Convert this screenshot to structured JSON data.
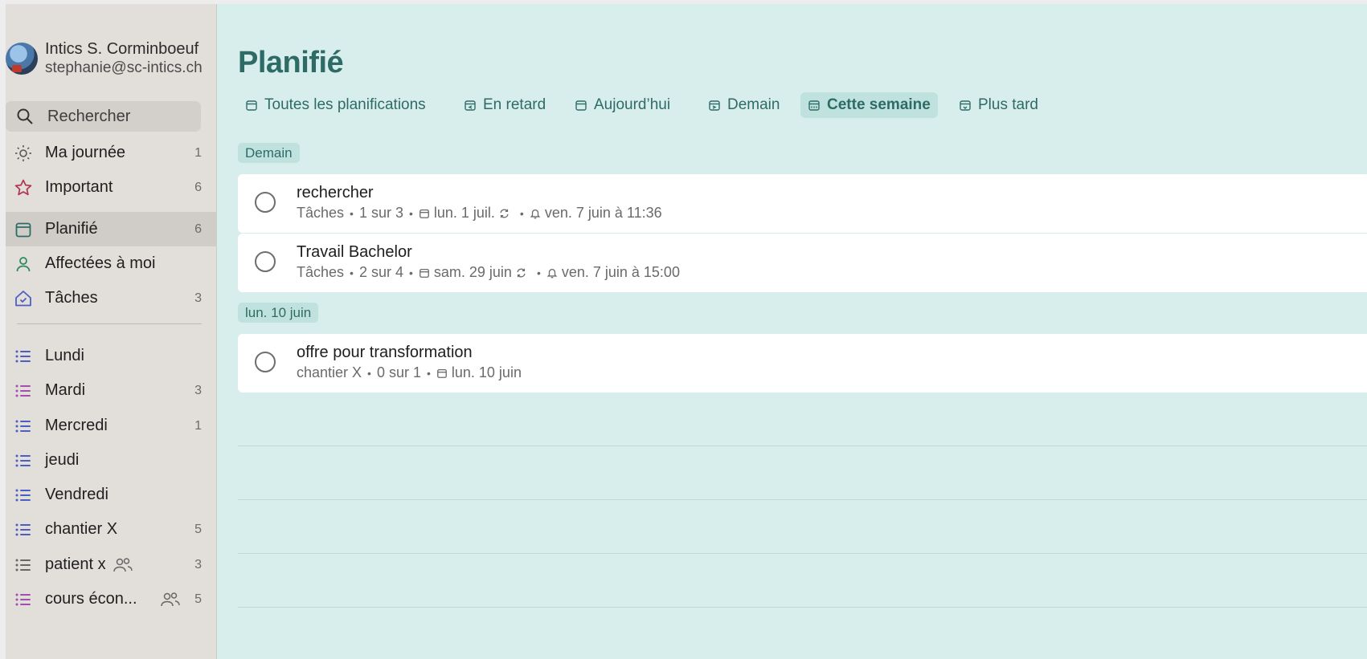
{
  "profile": {
    "name": "Intics S. Corminboeuf",
    "email": "stephanie@sc-intics.ch"
  },
  "search": {
    "placeholder": "Rechercher"
  },
  "sidebar": {
    "items": [
      {
        "label": "Ma journée",
        "count": "1",
        "icon": "sun-icon"
      },
      {
        "label": "Important",
        "count": "6",
        "icon": "star-icon"
      },
      {
        "label": "Planifié",
        "count": "6",
        "icon": "calendar-icon",
        "active": true
      },
      {
        "label": "Affectées à moi",
        "count": "",
        "icon": "person-icon"
      },
      {
        "label": "Tâches",
        "count": "3",
        "icon": "home-icon"
      }
    ],
    "lists": [
      {
        "label": "Lundi",
        "count": "",
        "icon": "list-icon"
      },
      {
        "label": "Mardi",
        "count": "3",
        "icon": "list-icon"
      },
      {
        "label": "Mercredi",
        "count": "1",
        "icon": "list-icon"
      },
      {
        "label": "jeudi",
        "count": "",
        "icon": "list-icon"
      },
      {
        "label": "Vendredi",
        "count": "",
        "icon": "list-icon"
      },
      {
        "label": "chantier X",
        "count": "5",
        "icon": "list-icon"
      },
      {
        "label": "patient x",
        "count": "3",
        "icon": "list-icon",
        "shared": true
      },
      {
        "label": "cours écon...",
        "count": "5",
        "icon": "list-icon",
        "shared": true
      }
    ]
  },
  "main": {
    "title": "Planifié",
    "filters": [
      "Toutes les planifications",
      "En retard",
      "Aujourd’hui",
      "Demain",
      "Cette semaine",
      "Plus tard"
    ],
    "active_filter": "Cette semaine",
    "groups": [
      {
        "label": "Demain",
        "tasks": [
          {
            "title": "rechercher",
            "list": "Tâches",
            "steps": "1 sur 3",
            "due": "lun. 1 juil.",
            "reminder": "ven. 7 juin à 11:36"
          },
          {
            "title": "Travail Bachelor",
            "list": "Tâches",
            "steps": "2 sur 4",
            "due": "sam. 29 juin",
            "reminder": "ven. 7 juin à 15:00"
          }
        ]
      },
      {
        "label": "lun. 10 juin",
        "tasks": [
          {
            "title": "offre pour transformation",
            "list": "chantier X",
            "steps": "0 sur 1",
            "due": "lun. 10 juin"
          }
        ]
      }
    ]
  },
  "colors": {
    "accent": "#2e6b66",
    "main_bg": "#d8eeec",
    "sidebar_bg": "#e2dfdb",
    "chip_bg": "#c0e2de"
  }
}
